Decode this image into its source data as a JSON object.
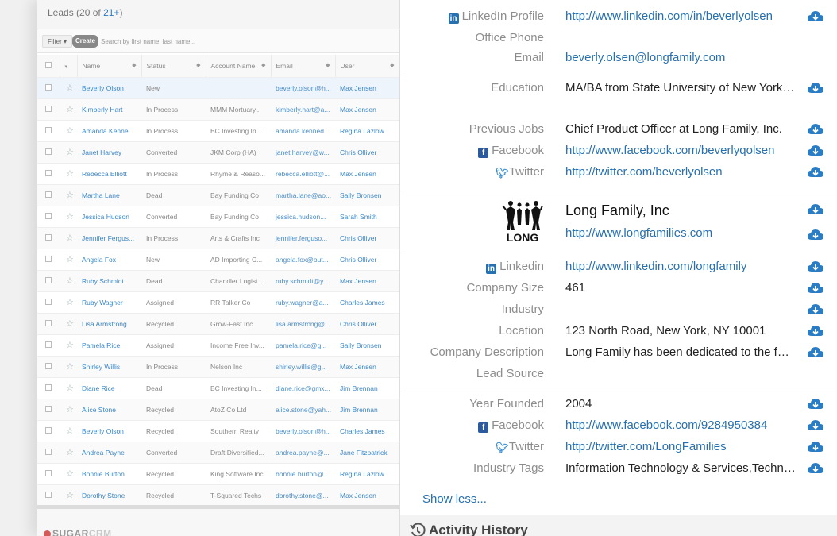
{
  "leads": {
    "title": "Leads",
    "count_prefix": "(20 of ",
    "count_link": "21+",
    "count_suffix": ")",
    "filter_label": "Filter ▾",
    "create_label": "Create",
    "search_placeholder": "Search by first name, last name...",
    "columns": [
      "Name",
      "Status",
      "Account Name",
      "Email",
      "User"
    ],
    "rows": [
      {
        "name": "Beverly Olson",
        "status": "New",
        "account": "",
        "email": "beverly.olson@h...",
        "user": "Max Jensen"
      },
      {
        "name": "Kimberly Hart",
        "status": "In Process",
        "account": "MMM Mortuary...",
        "email": "kimberly.hart@a...",
        "user": "Max Jensen"
      },
      {
        "name": "Amanda Kenne...",
        "status": "In Process",
        "account": "BC Investing In...",
        "email": "amanda.kenned...",
        "user": "Regina Lazlow"
      },
      {
        "name": "Janet Harvey",
        "status": "Converted",
        "account": "JKM Corp (HA)",
        "email": "janet.harvey@w...",
        "user": "Chris Olliver"
      },
      {
        "name": "Rebecca Elliott",
        "status": "In Process",
        "account": "Rhyme & Reaso...",
        "email": "rebecca.elliott@...",
        "user": "Max Jensen"
      },
      {
        "name": "Martha Lane",
        "status": "Dead",
        "account": "Bay Funding Co",
        "email": "martha.lane@ao...",
        "user": "Sally Bronsen"
      },
      {
        "name": "Jessica Hudson",
        "status": "Converted",
        "account": "Bay Funding Co",
        "email": "jessica.hudson...",
        "user": "Sarah Smith"
      },
      {
        "name": "Jennifer Fergus...",
        "status": "In Process",
        "account": "Arts & Crafts Inc",
        "email": "jennifer.ferguso...",
        "user": "Chris Olliver"
      },
      {
        "name": "Angela Fox",
        "status": "New",
        "account": "AD Importing C...",
        "email": "angela.fox@out...",
        "user": "Chris Olliver"
      },
      {
        "name": "Ruby Schmidt",
        "status": "Dead",
        "account": "Chandler Logist...",
        "email": "ruby.schmidt@y...",
        "user": "Max Jensen"
      },
      {
        "name": "Ruby Wagner",
        "status": "Assigned",
        "account": "RR Talker Co",
        "email": "ruby.wagner@a...",
        "user": "Charles James"
      },
      {
        "name": "Lisa Armstrong",
        "status": "Recycled",
        "account": "Grow-Fast Inc",
        "email": "lisa.armstrong@...",
        "user": "Chris Olliver"
      },
      {
        "name": "Pamela Rice",
        "status": "Assigned",
        "account": "Income Free Inv...",
        "email": "pamela.rice@g...",
        "user": "Sally Bronsen"
      },
      {
        "name": "Shirley Willis",
        "status": "In Process",
        "account": "Nelson Inc",
        "email": "shirley.willis@g...",
        "user": "Max Jensen"
      },
      {
        "name": "Diane Rice",
        "status": "Dead",
        "account": "BC Investing In...",
        "email": "diane.rice@gmx...",
        "user": "Jim Brennan"
      },
      {
        "name": "Alice Stone",
        "status": "Recycled",
        "account": "AtoZ Co Ltd",
        "email": "alice.stone@yah...",
        "user": "Jim Brennan"
      },
      {
        "name": "Beverly Olson",
        "status": "Recycled",
        "account": "Southern Realty",
        "email": "beverly.olson@h...",
        "user": "Charles James"
      },
      {
        "name": "Andrea Payne",
        "status": "Converted",
        "account": "Draft Diversified...",
        "email": "andrea.payne@...",
        "user": "Jane Fitzpatrick"
      },
      {
        "name": "Bonnie Burton",
        "status": "Recycled",
        "account": "King Software Inc",
        "email": "bonnie.burton@...",
        "user": "Regina Lazlow"
      },
      {
        "name": "Dorothy Stone",
        "status": "Recycled",
        "account": "T-Squared Techs",
        "email": "dorothy.stone@...",
        "user": "Max Jensen"
      }
    ],
    "logo_text_dark": "SUGAR",
    "logo_text_light": "CRM"
  },
  "detail": {
    "contact": {
      "linkedin_label": "LinkedIn Profile",
      "linkedin_value": "http://www.linkedin.com/in/beverlyolsen",
      "office_phone_label": "Office Phone",
      "email_label": "Email",
      "email_value": "beverly.olsen@longfamily.com"
    },
    "background": {
      "education_label": "Education",
      "education_value": "MA/BA from State University of New York, Albany",
      "previous_jobs_label": "Previous Jobs",
      "previous_jobs_value": "Chief Product Officer at Long Family, Inc.",
      "facebook_label": "Facebook",
      "facebook_value": "http://www.facebook.com/beverlyqolsen",
      "twitter_label": "Twitter",
      "twitter_value": "http://twitter.com/beverlyolsen"
    },
    "company": {
      "logo_text": "LONG",
      "name": "Long Family, Inc",
      "url": "http://www.longfamilies.com",
      "linkedin_label": "Linkedin",
      "linkedin_value": "http://www.linkedin.com/longfamily",
      "size_label": "Company Size",
      "size_value": "461",
      "industry_label": "Industry",
      "location_label": "Location",
      "location_value": "123 North Road, New York, NY 10001",
      "description_label": "Company Description",
      "description_value": "Long Family has been dedicated to the families of New York",
      "lead_source_label": "Lead Source",
      "year_founded_label": "Year Founded",
      "year_founded_value": "2004",
      "facebook_label": "Facebook",
      "facebook_value": "http://www.facebook.com/9284950384",
      "twitter_label": "Twitter",
      "twitter_value": "http://twitter.com/LongFamilies",
      "industry_tags_label": "Industry Tags",
      "industry_tags_value": "Information Technology & Services,Technology"
    },
    "show_less": "Show less...",
    "activity_title": "Activity History"
  },
  "colors": {
    "link": "#2670b0",
    "cloud": "#2a7cc4",
    "label": "#8d8d8d"
  }
}
